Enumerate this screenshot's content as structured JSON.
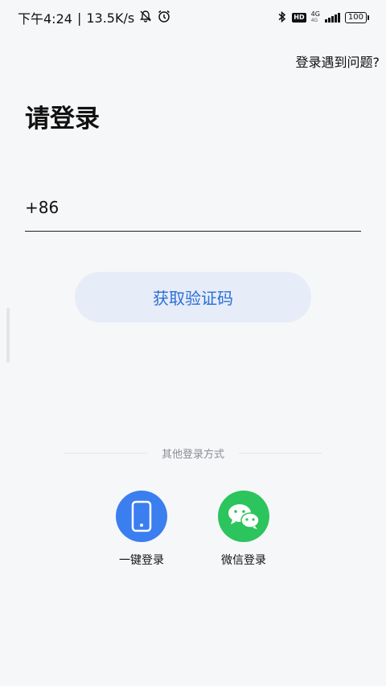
{
  "status_bar": {
    "time": "下午4:24",
    "separator": "|",
    "speed": "13.5K/s",
    "hd": "HD",
    "network_top": "4G",
    "network_bottom": "4G",
    "battery": "100"
  },
  "header": {
    "help_link": "登录遇到问题?"
  },
  "main": {
    "title": "请登录",
    "country_code": "+86",
    "phone_placeholder": "",
    "get_code_label": "获取验证码"
  },
  "other_login": {
    "divider_text": "其他登录方式",
    "options": [
      {
        "label": "一键登录",
        "icon": "phone-icon",
        "color": "#3b7ef0"
      },
      {
        "label": "微信登录",
        "icon": "wechat-icon",
        "color": "#2cc45c"
      }
    ]
  },
  "colors": {
    "background": "#f6f7f9",
    "accent": "#2a6fd6",
    "button_bg": "#e6ecf8"
  }
}
